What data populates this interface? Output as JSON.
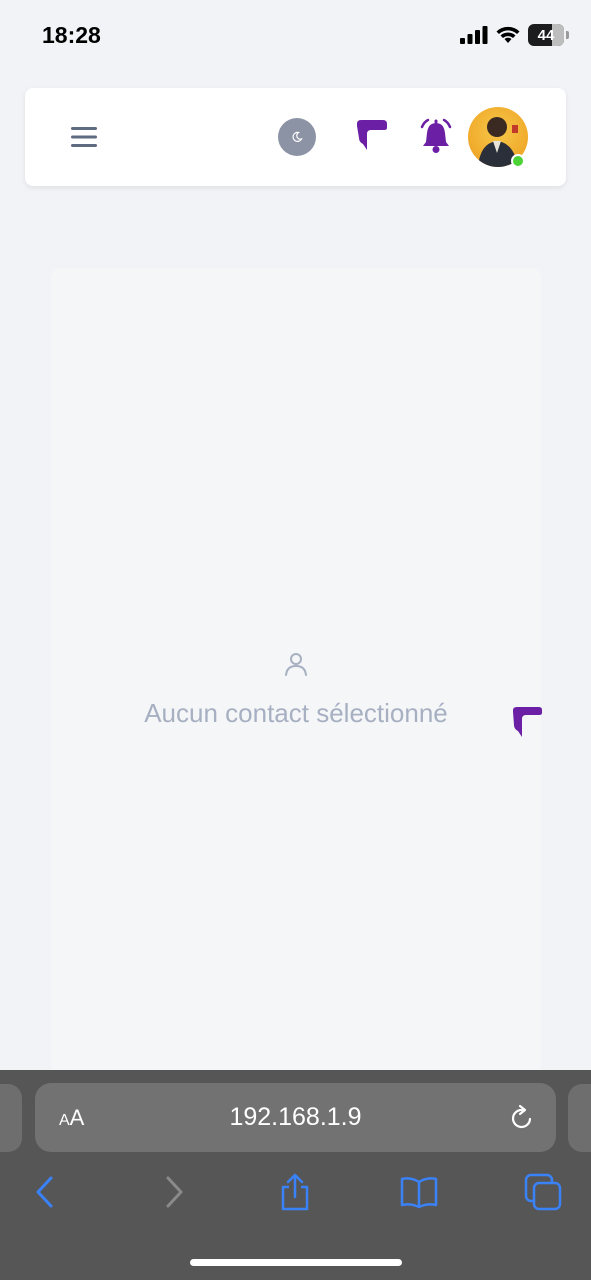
{
  "status_bar": {
    "time": "18:28",
    "battery": "44"
  },
  "header": {
    "menu_icon": "hamburger-menu-icon",
    "theme_icon": "moon-icon",
    "messages_icon": "chat-bubble-icon",
    "notifications_icon": "bell-icon",
    "avatar_status": "online"
  },
  "main": {
    "empty_icon": "user-icon",
    "empty_text": "Aucun contact sélectionné"
  },
  "browser": {
    "text_size_label_small": "A",
    "text_size_label_large": "A",
    "url": "192.168.1.9",
    "toolbar": [
      "back",
      "forward",
      "share",
      "bookmarks",
      "tabs"
    ]
  },
  "colors": {
    "accent_purple": "#6a1fa5",
    "ios_blue": "#3a82f7",
    "online_green": "#4cd137",
    "muted_text": "#a7b0c2"
  }
}
